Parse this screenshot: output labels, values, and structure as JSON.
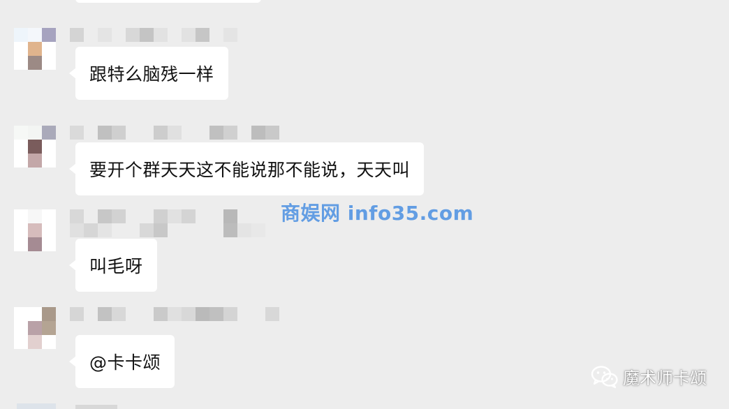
{
  "messages": [
    {
      "text": "跟特么脑残一样"
    },
    {
      "text": "要开个群天天这不能说那不能说，天天叫"
    },
    {
      "text": "叫毛呀"
    },
    {
      "text": "@卡卡颂"
    }
  ],
  "watermark": {
    "text": "商娱网 info35.com"
  },
  "account": {
    "name": "魔术师卡颂",
    "icon": "wechat-icon"
  },
  "colors": {
    "background": "#ededed",
    "bubble": "#ffffff",
    "watermark": "#4a90e2"
  }
}
